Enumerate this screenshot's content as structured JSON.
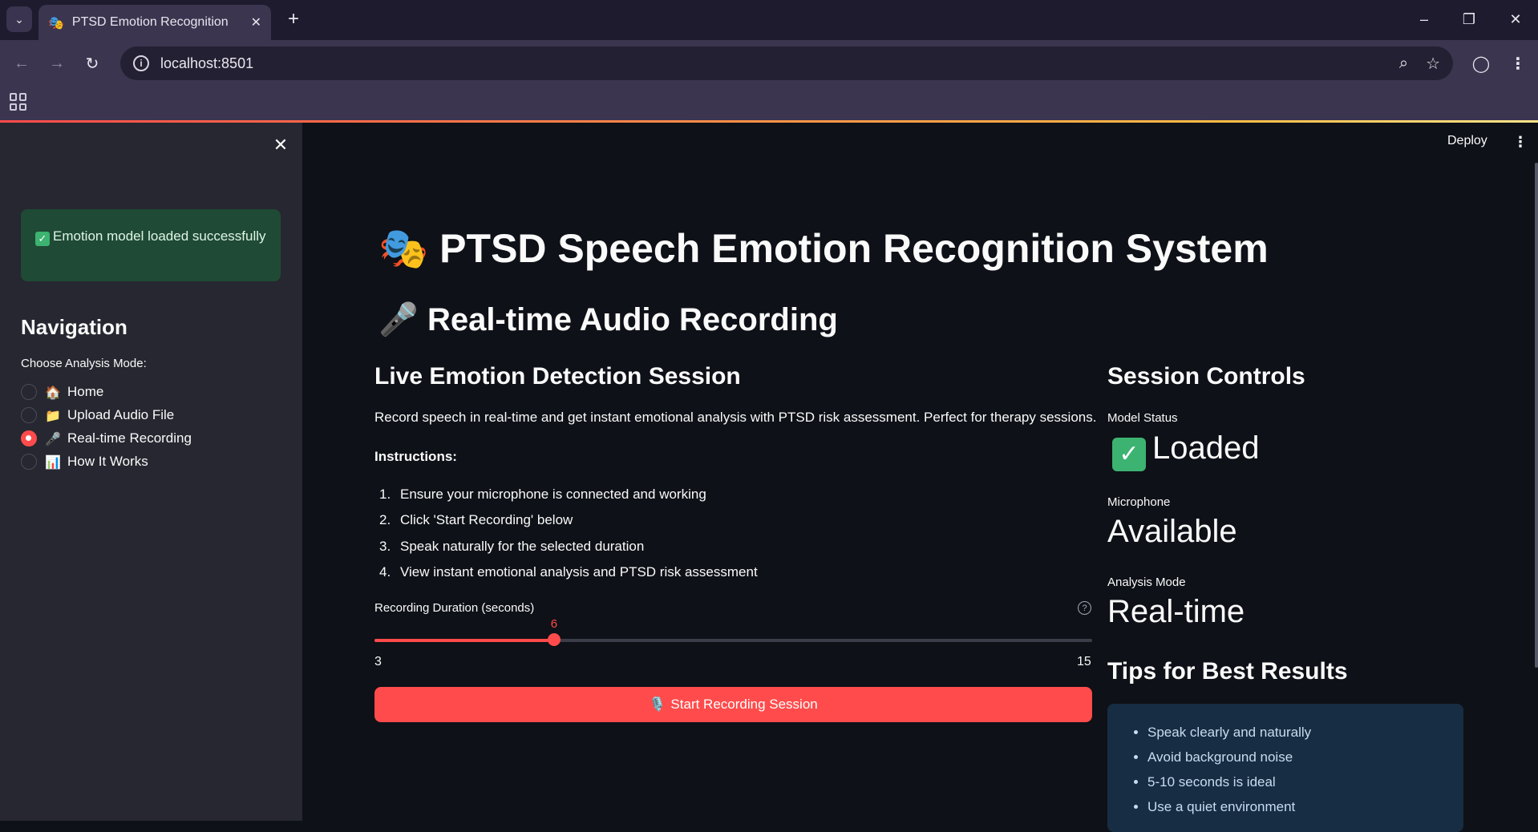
{
  "browser": {
    "tab_title": "PTSD Emotion Recognition",
    "tab_favicon": "🎭",
    "url": "localhost:8501"
  },
  "sidebar": {
    "alert_text": "Emotion model loaded successfully",
    "nav_heading": "Navigation",
    "radio_label": "Choose Analysis Mode:",
    "options": [
      {
        "icon": "🏠",
        "label": "Home",
        "selected": false
      },
      {
        "icon": "📁",
        "label": "Upload Audio File",
        "selected": false
      },
      {
        "icon": "🎤",
        "label": "Real-time Recording",
        "selected": true
      },
      {
        "icon": "📊",
        "label": "How It Works",
        "selected": false
      }
    ]
  },
  "header": {
    "deploy_label": "Deploy"
  },
  "main": {
    "title_icon": "🎭",
    "title": "PTSD Speech Emotion Recognition System",
    "subtitle_icon": "🎤",
    "subtitle": "Real-time Audio Recording",
    "session_heading": "Live Emotion Detection Session",
    "description": "Record speech in real-time and get instant emotional analysis with PTSD risk assessment. Perfect for therapy sessions.",
    "instructions_heading": "Instructions:",
    "instructions": [
      "Ensure your microphone is connected and working",
      "Click 'Start Recording' below",
      "Speak naturally for the selected duration",
      "View instant emotional analysis and PTSD risk assessment"
    ],
    "slider": {
      "label": "Recording Duration (seconds)",
      "value": "6",
      "min": "3",
      "max": "15"
    },
    "start_button_icon": "🎙️",
    "start_button": "Start Recording Session"
  },
  "controls": {
    "heading": "Session Controls",
    "model_status_label": "Model Status",
    "model_status_value": "Loaded",
    "microphone_label": "Microphone",
    "microphone_value": "Available",
    "analysis_mode_label": "Analysis Mode",
    "analysis_mode_value": "Real-time",
    "tips_heading": "Tips for Best Results",
    "tips": [
      "Speak clearly and naturally",
      "Avoid background noise",
      "5-10 seconds is ideal",
      "Use a quiet environment"
    ]
  },
  "colors": {
    "primary": "#ff4b4b",
    "success_bg": "#1f4a35",
    "info_bg": "#172d43",
    "sidebar_bg": "#262730",
    "main_bg": "#0e1117"
  }
}
